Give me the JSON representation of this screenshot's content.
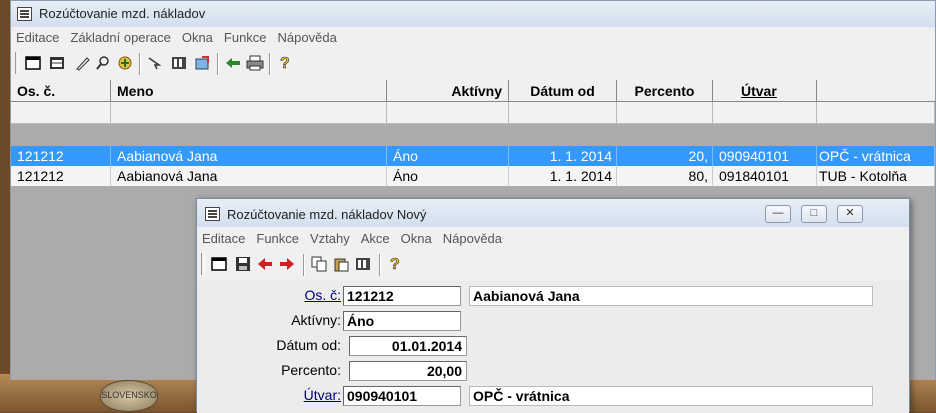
{
  "main_window": {
    "title": "Rozúčtovanie mzd. nákladov",
    "menu": [
      "Editace",
      "Základní operace",
      "Okna",
      "Funkce",
      "Nápověda"
    ],
    "toolbar_icons": [
      "new-record-icon",
      "table-view-icon",
      "edit-icon",
      "search-icon",
      "filter-icon",
      "select-icon",
      "columns-icon",
      "export-icon",
      "back-icon",
      "print-icon",
      "help-icon"
    ]
  },
  "grid": {
    "columns": [
      "Os. č.",
      "Meno",
      "Aktívny",
      "Dátum od",
      "Percento",
      "Útvar",
      ""
    ],
    "rows": [
      {
        "os_c": "121212",
        "meno": "Aabianová Jana",
        "aktivny": "Áno",
        "datum_od": "1. 1. 2014",
        "percento": "20,",
        "utvar": "090940101",
        "utvar_nazov": "OPČ - vrátnica",
        "selected": true
      },
      {
        "os_c": "121212",
        "meno": "Aabianová Jana",
        "aktivny": "Áno",
        "datum_od": "1. 1. 2014",
        "percento": "80,",
        "utvar": "091840101",
        "utvar_nazov": "TUB - Kotolňa",
        "selected": false
      }
    ]
  },
  "dialog": {
    "title": "Rozúčtovanie mzd. nákladov Nový",
    "menu": [
      "Editace",
      "Funkce",
      "Vztahy",
      "Akce",
      "Okna",
      "Nápověda"
    ],
    "window_buttons": {
      "minimize": "—",
      "maximize": "□",
      "close": "✕"
    },
    "form": {
      "os_c_label": "Os. č:",
      "os_c_value": "121212",
      "meno_value": "Aabianová Jana",
      "aktivny_label": "Aktívny:",
      "aktivny_value": "Áno",
      "datum_label": "Dátum od:",
      "datum_value": "01.01.2014",
      "percento_label": "Percento:",
      "percento_value": "20,00",
      "utvar_label": "Útvar:",
      "utvar_value": "090940101",
      "utvar_nazov_value": "OPČ - vrátnica"
    }
  },
  "background": {
    "coin_text": "SLOVENSKO"
  },
  "colors": {
    "selection": "#3399ff",
    "grid_bg": "#ababab"
  }
}
